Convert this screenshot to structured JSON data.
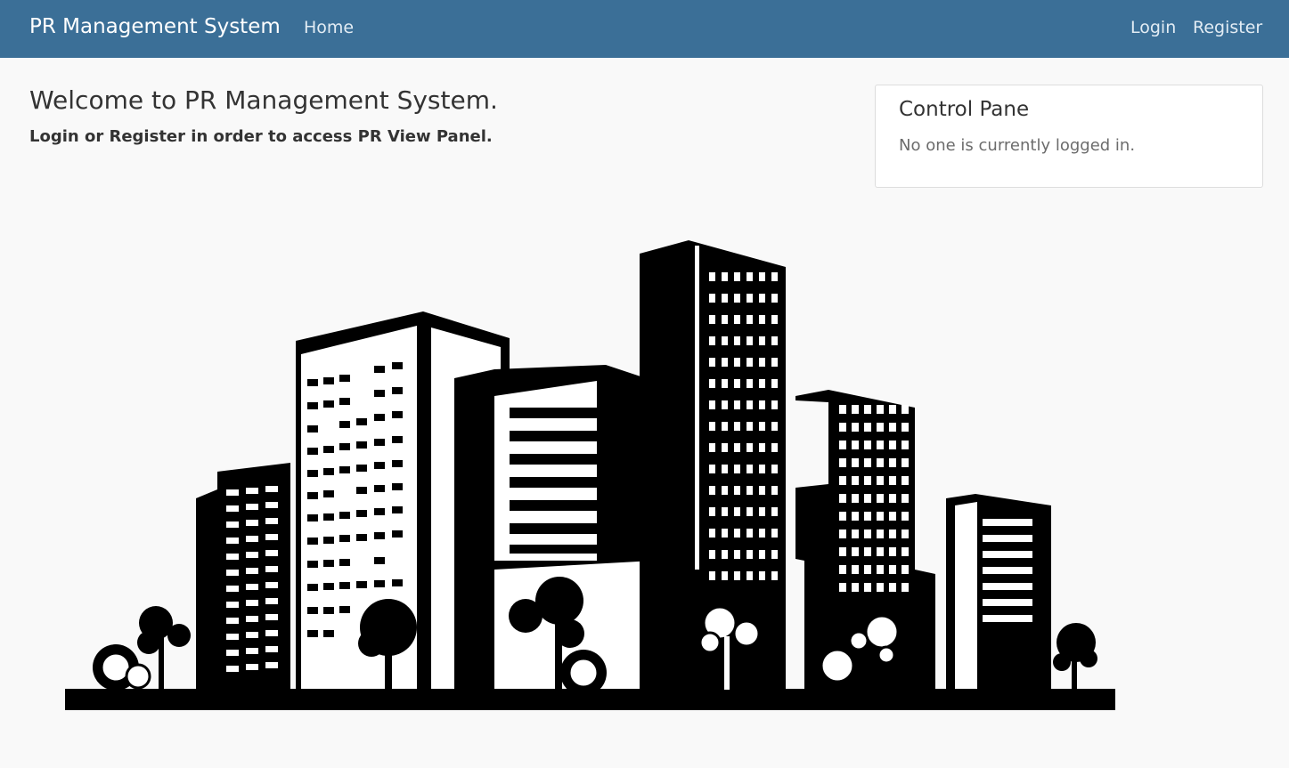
{
  "navbar": {
    "brand": "PR Management System",
    "links": {
      "home": "Home",
      "login": "Login",
      "register": "Register"
    },
    "background_color": "#3b6f97"
  },
  "main": {
    "heading": "Welcome to PR Management System.",
    "subheading": "Login or Register in order to access PR View Panel."
  },
  "control_panel": {
    "title": "Control Pane",
    "status": "No one is currently logged in."
  },
  "illustration": {
    "name": "city-skyline-icon"
  }
}
